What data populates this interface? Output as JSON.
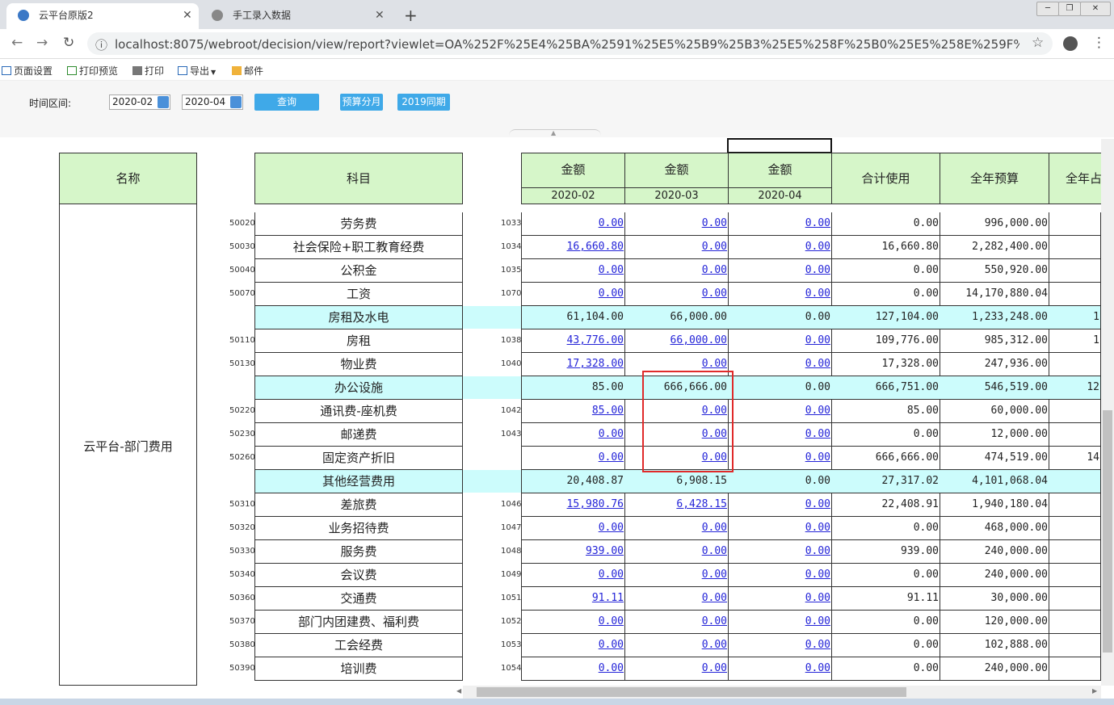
{
  "browser": {
    "tabs": [
      {
        "label": "云平台原版2",
        "active": true
      },
      {
        "label": "手工录入数据",
        "active": false
      }
    ],
    "url": "localhost:8075/webroot/decision/view/report?viewlet=OA%252F%25E4%25BA%2591%25E5%25B9%25B3%25E5%258F%25B0%25E5%258E%259F%25E7%2589%25258..."
  },
  "toolbar": {
    "page_setup": "页面设置",
    "print_preview": "打印预览",
    "print": "打印",
    "export": "导出",
    "mail": "邮件"
  },
  "filter": {
    "label": "时间区间:",
    "start": "2020-02",
    "end": "2020-04",
    "query": "查询",
    "budget_split": "预算分月",
    "same_period_2019": "2019同期"
  },
  "header": {
    "name": "名称",
    "subject": "科目",
    "amount": "金额",
    "months": [
      "2020-02",
      "2020-03",
      "2020-04"
    ],
    "total_used": "合计使用",
    "annual_budget": "全年预算",
    "annual_ratio": "全年占"
  },
  "dept_name": "云平台-部门费用",
  "rows": [
    {
      "code": "50020",
      "subject": "劳务费",
      "num": "1033",
      "m1": "0.00",
      "m2": "0.00",
      "m3": "0.00",
      "total": "0.00",
      "budget": "996,000.00",
      "ratio": "",
      "group": false
    },
    {
      "code": "50030",
      "subject": "社会保险+职工教育经费",
      "num": "1034",
      "m1": "16,660.80",
      "m2": "0.00",
      "m3": "0.00",
      "total": "16,660.80",
      "budget": "2,282,400.00",
      "ratio": "",
      "group": false
    },
    {
      "code": "50040",
      "subject": "公积金",
      "num": "1035",
      "m1": "0.00",
      "m2": "0.00",
      "m3": "0.00",
      "total": "0.00",
      "budget": "550,920.00",
      "ratio": "",
      "group": false
    },
    {
      "code": "50070",
      "subject": "工资",
      "num": "1070",
      "m1": "0.00",
      "m2": "0.00",
      "m3": "0.00",
      "total": "0.00",
      "budget": "14,170,880.04",
      "ratio": "",
      "group": false
    },
    {
      "code": "",
      "subject": "房租及水电",
      "num": "",
      "m1": "61,104.00",
      "m2": "66,000.00",
      "m3": "0.00",
      "total": "127,104.00",
      "budget": "1,233,248.00",
      "ratio": "1",
      "group": true
    },
    {
      "code": "50110",
      "subject": "房租",
      "num": "1038",
      "m1": "43,776.00",
      "m2": "66,000.00",
      "m3": "0.00",
      "total": "109,776.00",
      "budget": "985,312.00",
      "ratio": "1",
      "group": false
    },
    {
      "code": "50130",
      "subject": "物业费",
      "num": "1040",
      "m1": "17,328.00",
      "m2": "0.00",
      "m3": "0.00",
      "total": "17,328.00",
      "budget": "247,936.00",
      "ratio": "",
      "group": false
    },
    {
      "code": "",
      "subject": "办公设施",
      "num": "",
      "m1": "85.00",
      "m2": "666,666.00",
      "m3": "0.00",
      "total": "666,751.00",
      "budget": "546,519.00",
      "ratio": "12",
      "group": true
    },
    {
      "code": "50220",
      "subject": "通讯费-座机费",
      "num": "1042",
      "m1": "85.00",
      "m2": "0.00",
      "m3": "0.00",
      "total": "85.00",
      "budget": "60,000.00",
      "ratio": "",
      "group": false
    },
    {
      "code": "50230",
      "subject": "邮递费",
      "num": "1043",
      "m1": "0.00",
      "m2": "0.00",
      "m3": "0.00",
      "total": "0.00",
      "budget": "12,000.00",
      "ratio": "",
      "group": false
    },
    {
      "code": "50260",
      "subject": "固定资产折旧",
      "num": "",
      "m1": "0.00",
      "m2": "0.00",
      "m3": "0.00",
      "total": "666,666.00",
      "budget": "474,519.00",
      "ratio": "14",
      "group": false
    },
    {
      "code": "",
      "subject": "其他经营费用",
      "num": "",
      "m1": "20,408.87",
      "m2": "6,908.15",
      "m3": "0.00",
      "total": "27,317.02",
      "budget": "4,101,068.04",
      "ratio": "",
      "group": true
    },
    {
      "code": "50310",
      "subject": "差旅费",
      "num": "1046",
      "m1": "15,980.76",
      "m2": "6,428.15",
      "m3": "0.00",
      "total": "22,408.91",
      "budget": "1,940,180.04",
      "ratio": "",
      "group": false
    },
    {
      "code": "50320",
      "subject": "业务招待费",
      "num": "1047",
      "m1": "0.00",
      "m2": "0.00",
      "m3": "0.00",
      "total": "0.00",
      "budget": "468,000.00",
      "ratio": "",
      "group": false
    },
    {
      "code": "50330",
      "subject": "服务费",
      "num": "1048",
      "m1": "939.00",
      "m2": "0.00",
      "m3": "0.00",
      "total": "939.00",
      "budget": "240,000.00",
      "ratio": "",
      "group": false
    },
    {
      "code": "50340",
      "subject": "会议费",
      "num": "1049",
      "m1": "0.00",
      "m2": "0.00",
      "m3": "0.00",
      "total": "0.00",
      "budget": "240,000.00",
      "ratio": "",
      "group": false
    },
    {
      "code": "50360",
      "subject": "交通费",
      "num": "1051",
      "m1": "91.11",
      "m2": "0.00",
      "m3": "0.00",
      "total": "91.11",
      "budget": "30,000.00",
      "ratio": "",
      "group": false
    },
    {
      "code": "50370",
      "subject": "部门内团建费、福利费",
      "num": "1052",
      "m1": "0.00",
      "m2": "0.00",
      "m3": "0.00",
      "total": "0.00",
      "budget": "120,000.00",
      "ratio": "",
      "group": false
    },
    {
      "code": "50380",
      "subject": "工会经费",
      "num": "1053",
      "m1": "0.00",
      "m2": "0.00",
      "m3": "0.00",
      "total": "0.00",
      "budget": "102,888.00",
      "ratio": "",
      "group": false
    },
    {
      "code": "50390",
      "subject": "培训费",
      "num": "1054",
      "m1": "0.00",
      "m2": "0.00",
      "m3": "0.00",
      "total": "0.00",
      "budget": "240,000.00",
      "ratio": "",
      "group": false
    }
  ]
}
